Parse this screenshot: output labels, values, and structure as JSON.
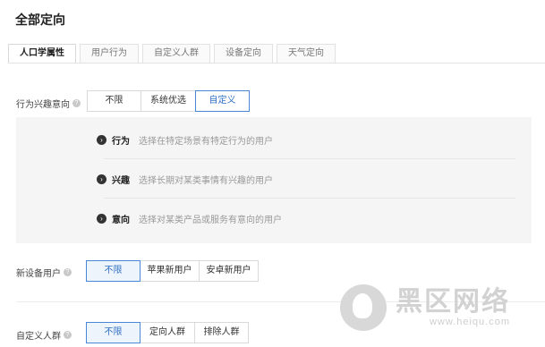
{
  "page": {
    "title": "全部定向"
  },
  "tabs": [
    {
      "label": "人口学属性",
      "active": true
    },
    {
      "label": "用户行为",
      "active": false
    },
    {
      "label": "自定义人群",
      "active": false
    },
    {
      "label": "设备定向",
      "active": false
    },
    {
      "label": "天气定向",
      "active": false
    }
  ],
  "behavior_interest": {
    "label": "行为兴趣意向",
    "help_icon": "question-icon",
    "options": [
      "不限",
      "系统优选",
      "自定义"
    ],
    "selected": "自定义",
    "panel": [
      {
        "icon": "chevron-right-icon",
        "name": "行为",
        "desc": "选择在特定场景有特定行为的用户"
      },
      {
        "icon": "chevron-right-icon",
        "name": "兴趣",
        "desc": "选择长期对某类事情有兴趣的用户"
      },
      {
        "icon": "chevron-right-icon",
        "name": "意向",
        "desc": "选择对某类产品或服务有意向的用户"
      }
    ]
  },
  "new_device_user": {
    "label": "新设备用户",
    "help_icon": "question-icon",
    "options": [
      "不限",
      "苹果新用户",
      "安卓新用户"
    ],
    "selected": "不限"
  },
  "custom_audience": {
    "label": "自定义人群",
    "help_icon": "question-icon",
    "options": [
      "不限",
      "定向人群",
      "排除人群"
    ],
    "selected": "不限"
  },
  "watermark": {
    "big_text": "黑区网络",
    "url": "www.heiqu.com"
  },
  "colors": {
    "accent": "#4a86d6",
    "panel_bg": "#f5f5f5"
  }
}
